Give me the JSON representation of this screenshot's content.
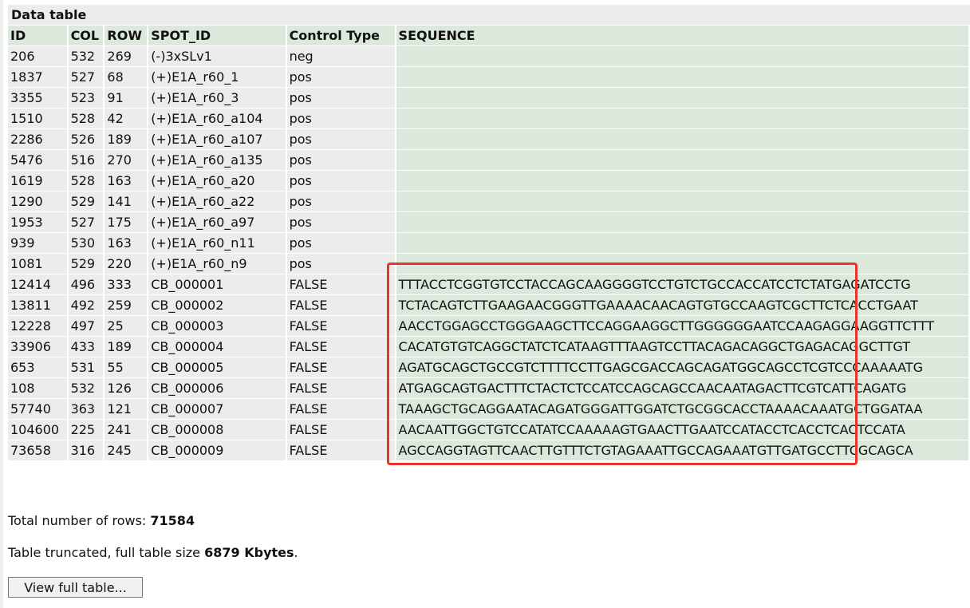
{
  "table": {
    "caption": "Data table",
    "headers": [
      "ID",
      "COL",
      "ROW",
      "SPOT_ID",
      "Control Type",
      "SEQUENCE"
    ],
    "rows": [
      [
        "206",
        "532",
        "269",
        "(-)3xSLv1",
        "neg",
        ""
      ],
      [
        "1837",
        "527",
        "68",
        "(+)E1A_r60_1",
        "pos",
        ""
      ],
      [
        "3355",
        "523",
        "91",
        "(+)E1A_r60_3",
        "pos",
        ""
      ],
      [
        "1510",
        "528",
        "42",
        "(+)E1A_r60_a104",
        "pos",
        ""
      ],
      [
        "2286",
        "526",
        "189",
        "(+)E1A_r60_a107",
        "pos",
        ""
      ],
      [
        "5476",
        "516",
        "270",
        "(+)E1A_r60_a135",
        "pos",
        ""
      ],
      [
        "1619",
        "528",
        "163",
        "(+)E1A_r60_a20",
        "pos",
        ""
      ],
      [
        "1290",
        "529",
        "141",
        "(+)E1A_r60_a22",
        "pos",
        ""
      ],
      [
        "1953",
        "527",
        "175",
        "(+)E1A_r60_a97",
        "pos",
        ""
      ],
      [
        "939",
        "530",
        "163",
        "(+)E1A_r60_n11",
        "pos",
        ""
      ],
      [
        "1081",
        "529",
        "220",
        "(+)E1A_r60_n9",
        "pos",
        ""
      ],
      [
        "12414",
        "496",
        "333",
        "CB_000001",
        "FALSE",
        "TTTACCTCGGTGTCCTACCAGCAAGGGGTCCTGTCTGCCACCATCCTCTATGAGATCCTG"
      ],
      [
        "13811",
        "492",
        "259",
        "CB_000002",
        "FALSE",
        "TCTACAGTCTTGAAGAACGGGTTGAAAACAACAGTGTGCCAAGTCGCTTCTCACCTGAAT"
      ],
      [
        "12228",
        "497",
        "25",
        "CB_000003",
        "FALSE",
        "AACCTGGAGCCTGGGAAGCTTCCAGGAAGGCTTGGGGGGAATCCAAGAGGAAGGTTCTTT"
      ],
      [
        "33906",
        "433",
        "189",
        "CB_000004",
        "FALSE",
        "CACATGTGTCAGGCTATCTCATAAGTTTAAGTCCTTACAGACAGGCTGAGACAGGCTTGT"
      ],
      [
        "653",
        "531",
        "55",
        "CB_000005",
        "FALSE",
        "AGATGCAGCTGCCGTCTTTTCCTTGAGCGACCAGCAGATGGCAGCCTCGTCCCAAAAATG"
      ],
      [
        "108",
        "532",
        "126",
        "CB_000006",
        "FALSE",
        "ATGAGCAGTGACTTTCTACTCTCCATCCAGCAGCCAACAATAGACTTCGTCATTCAGATG"
      ],
      [
        "57740",
        "363",
        "121",
        "CB_000007",
        "FALSE",
        "TAAAGCTGCAGGAATACAGATGGGATTGGATCTGCGGCACCTAAAACAAATGCTGGATAA"
      ],
      [
        "104600",
        "225",
        "241",
        "CB_000008",
        "FALSE",
        "AACAATTGGCTGTCCATATCCAAAAAGTGAACTTGAATCCATACCTCACCTCACTCCATA"
      ],
      [
        "73658",
        "316",
        "245",
        "CB_000009",
        "FALSE",
        "AGCCAGGTAGTTCAACTTGTTTCTGTAGAAATTGCCAGAAATGTTGATGCCTTCGCAGCA"
      ]
    ]
  },
  "footer": {
    "total_label": "Total number of rows: ",
    "total_value": "71584",
    "trunc_label": "Table truncated, full table size ",
    "trunc_value": "6879 Kbytes",
    "trunc_suffix": "."
  },
  "button": {
    "label": "View full table..."
  },
  "colors": {
    "highlight": "#e8342b",
    "header_bg": "#dce8dc",
    "cell_bg": "#ececec"
  }
}
